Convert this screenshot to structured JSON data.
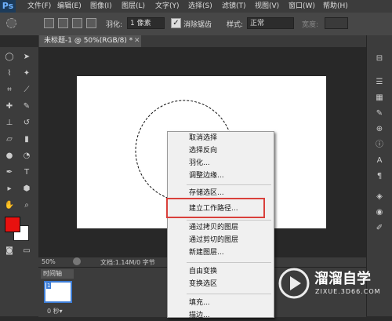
{
  "app": {
    "logo": "Ps"
  },
  "menubar": {
    "items": [
      "文件(F)",
      "编辑(E)",
      "图像(I)",
      "图层(L)",
      "文字(Y)",
      "选择(S)",
      "滤镜(T)",
      "视图(V)",
      "窗口(W)",
      "帮助(H)"
    ]
  },
  "options": {
    "feather_label": "羽化:",
    "feather_value": "1 像素",
    "antialias_label": "消除锯齿",
    "style_label": "样式:",
    "style_value": "正常",
    "width_label": "宽度:"
  },
  "document": {
    "tab_label": "未标题-1 @ 50%(RGB/8) *"
  },
  "status": {
    "zoom": "50%",
    "doc_info": "文档:1.14M/0 字节"
  },
  "timeline": {
    "tab_label": "时间轴",
    "frame_number": "1",
    "frame_delay": "0 秒▾"
  },
  "context_menu": {
    "items": [
      {
        "label": "取消选择"
      },
      {
        "label": "选择反向"
      },
      {
        "label": "羽化..."
      },
      {
        "label": "调整边缘..."
      },
      {
        "label": "存储选区..."
      },
      {
        "label": "建立工作路径..."
      },
      {
        "label": "通过拷贝的图层"
      },
      {
        "label": "通过剪切的图层"
      },
      {
        "label": "新建图层..."
      },
      {
        "label": "自由变换"
      },
      {
        "label": "变换选区"
      },
      {
        "label": "填充..."
      },
      {
        "label": "描边..."
      }
    ]
  },
  "watermark": {
    "title": "溜溜自学",
    "url": "ZIXUE.3D66.COM"
  },
  "colors": {
    "foreground": "#e8110f",
    "background": "#ffffff",
    "highlight_box": "#d9403b"
  }
}
